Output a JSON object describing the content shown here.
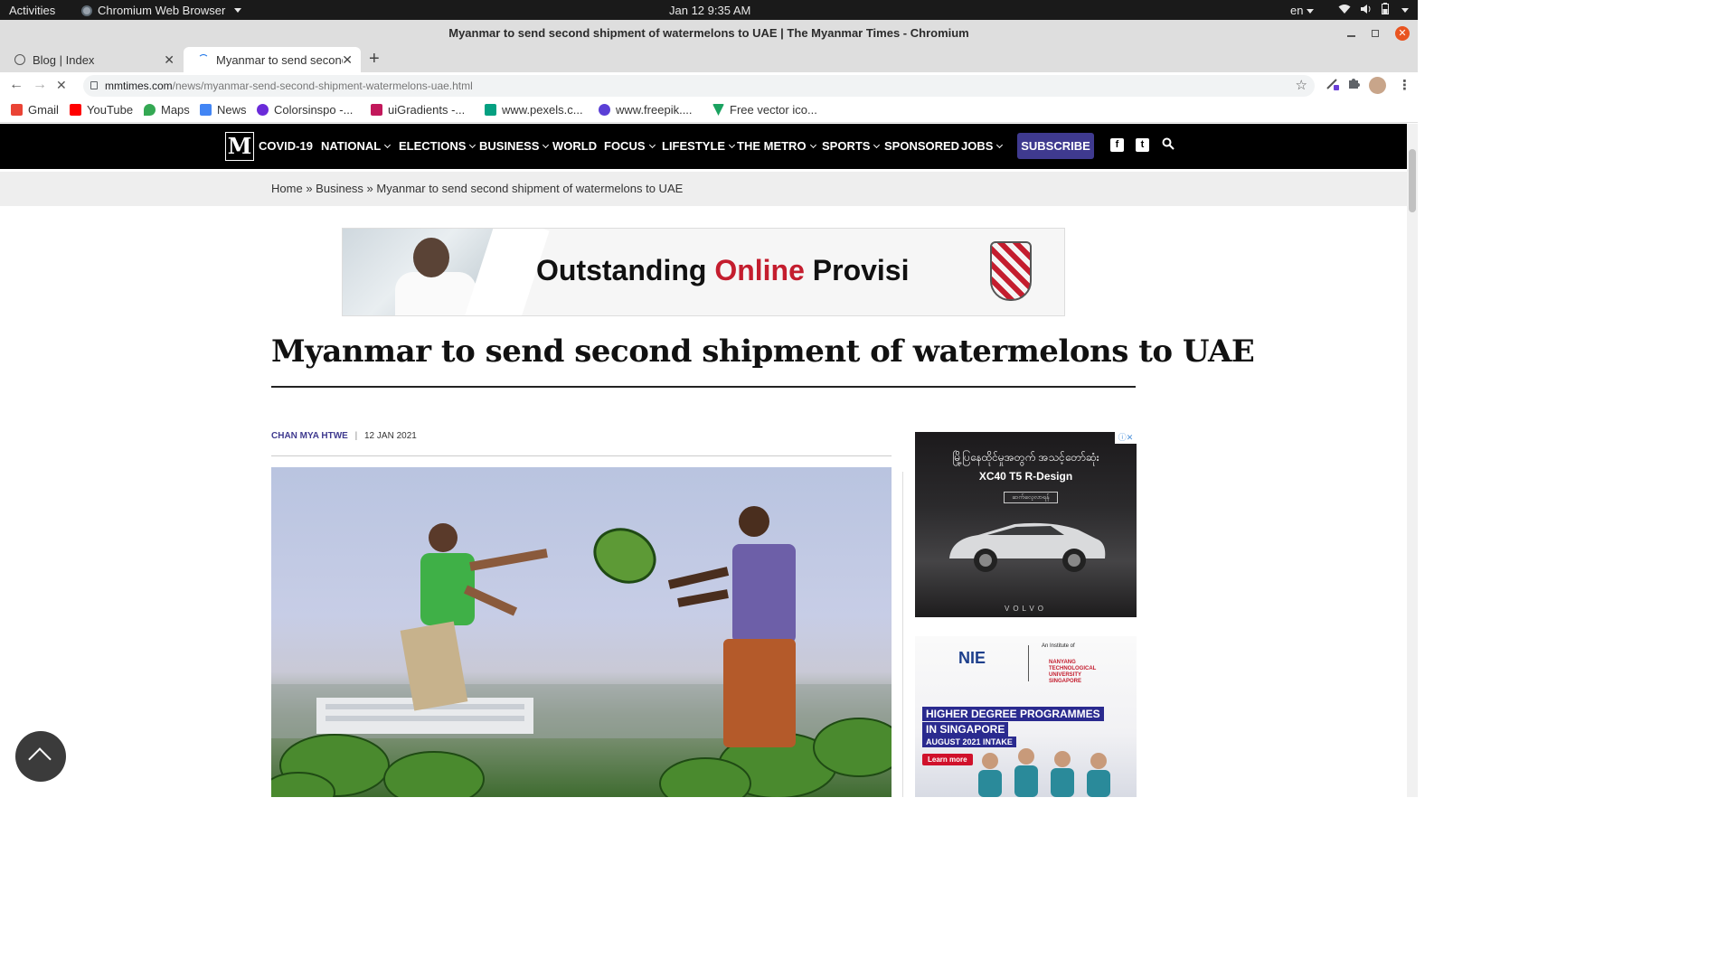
{
  "os": {
    "activities": "Activities",
    "app_name": "Chromium Web Browser",
    "clock": "Jan 12  9:35 AM",
    "lang": "en"
  },
  "window": {
    "title": "Myanmar to send second shipment of watermelons to UAE | The Myanmar Times - Chromium"
  },
  "tabs": [
    {
      "title": "Blog | Index"
    },
    {
      "title": "Myanmar to send second"
    }
  ],
  "omnibox": {
    "host": "mmtimes.com",
    "path": "/news/myanmar-send-second-shipment-watermelons-uae.html"
  },
  "bookmarks": [
    {
      "label": "Gmail",
      "color": "#ea4335"
    },
    {
      "label": "YouTube",
      "color": "#ff0000"
    },
    {
      "label": "Maps",
      "color": "#34a853"
    },
    {
      "label": "News",
      "color": "#4285f4"
    },
    {
      "label": "Colorsinspo -...",
      "color": "#6a2bd9"
    },
    {
      "label": "uiGradients -...",
      "color": "#c2185b"
    },
    {
      "label": "www.pexels.c...",
      "color": "#05a081"
    },
    {
      "label": "www.freepik....",
      "color": "#5a3fd6"
    },
    {
      "label": "Free vector ico...",
      "color": "#1aa260"
    }
  ],
  "site_nav": {
    "logo": "M",
    "items": [
      {
        "label": "COVID-19"
      },
      {
        "label": "NATIONAL"
      },
      {
        "label": "ELECTIONS"
      },
      {
        "label": "BUSINESS"
      },
      {
        "label": "WORLD"
      },
      {
        "label": "FOCUS"
      },
      {
        "label": "LIFESTYLE"
      },
      {
        "label": "THE METRO"
      },
      {
        "label": "SPORTS"
      },
      {
        "label": "SPONSORED"
      },
      {
        "label": "JOBS"
      }
    ],
    "subscribe": "SUBSCRIBE"
  },
  "breadcrumb": {
    "home": "Home",
    "sep": "»",
    "section": "Business",
    "current": "Myanmar to send second shipment of watermelons to UAE"
  },
  "banner_ad": {
    "text_a": "Outstanding ",
    "text_b": "Online",
    "text_c": " Provisi"
  },
  "article": {
    "headline": "Myanmar to send second shipment of watermelons to UAE",
    "author": "CHAN MYA HTWE",
    "date": "12 JAN 2021"
  },
  "side_ads": {
    "volvo": {
      "burmese": "မြို့ပြနေထိုင်မှုအတွက် အသင့်တော်ဆုံး",
      "model": "XC40 T5 R-Design",
      "cta": "ဆက်လေ့လာရန်",
      "brand": "VOLVO"
    },
    "nie": {
      "logo": "NIE",
      "institute_of": "An Institute of",
      "ntu": "NANYANG TECHNOLOGICAL UNIVERSITY SINGAPORE",
      "line1": "HIGHER DEGREE PROGRAMMES",
      "line2": "IN SINGAPORE",
      "line3": "AUGUST 2021 INTAKE",
      "learn": "Learn more"
    }
  }
}
